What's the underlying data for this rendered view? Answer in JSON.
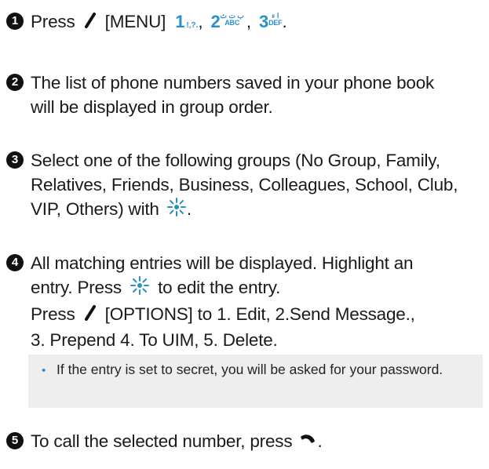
{
  "steps": [
    {
      "number": "1",
      "parts": {
        "press": "Press",
        "menu": "[MENU]",
        "key1_digit": "1",
        "key1_chars": "!,?.",
        "key2_digit": "2",
        "key2_top": "ب ت ث",
        "key2_bottom": "ABC",
        "key3_digit": "3",
        "key3_top": "ا ء",
        "key3_bottom": "DEF",
        "sep": ",",
        "end": "."
      }
    },
    {
      "number": "2",
      "lines": [
        "The list of phone numbers saved in your phone book",
        "will be displayed in group order."
      ]
    },
    {
      "number": "3",
      "lines": [
        "Select one of the following groups (No Group, Family,",
        "Relatives, Friends, Business, Colleagues, School, Club,",
        "VIP, Others) with",
        "."
      ]
    },
    {
      "number": "4",
      "lines": [
        "All matching entries will be displayed. Highlight an",
        "entry. Press",
        "to edit the entry.",
        "Press",
        "[OPTIONS] to 1. Edit, 2.Send Message.,",
        "3. Prepend 4. To UIM, 5. Delete."
      ]
    },
    {
      "number": "5",
      "lines": [
        "To call the selected number, press",
        "."
      ]
    }
  ],
  "note": {
    "bullet": "•",
    "text": "If the entry is set to secret, you will be asked for your password."
  },
  "colors": {
    "accent": "#2a91c8",
    "note_bg": "#eeeeee",
    "text": "#1a1a1a"
  },
  "icons": [
    "soft-key-slash-icon",
    "navigation-key-icon",
    "send-call-key-icon"
  ]
}
